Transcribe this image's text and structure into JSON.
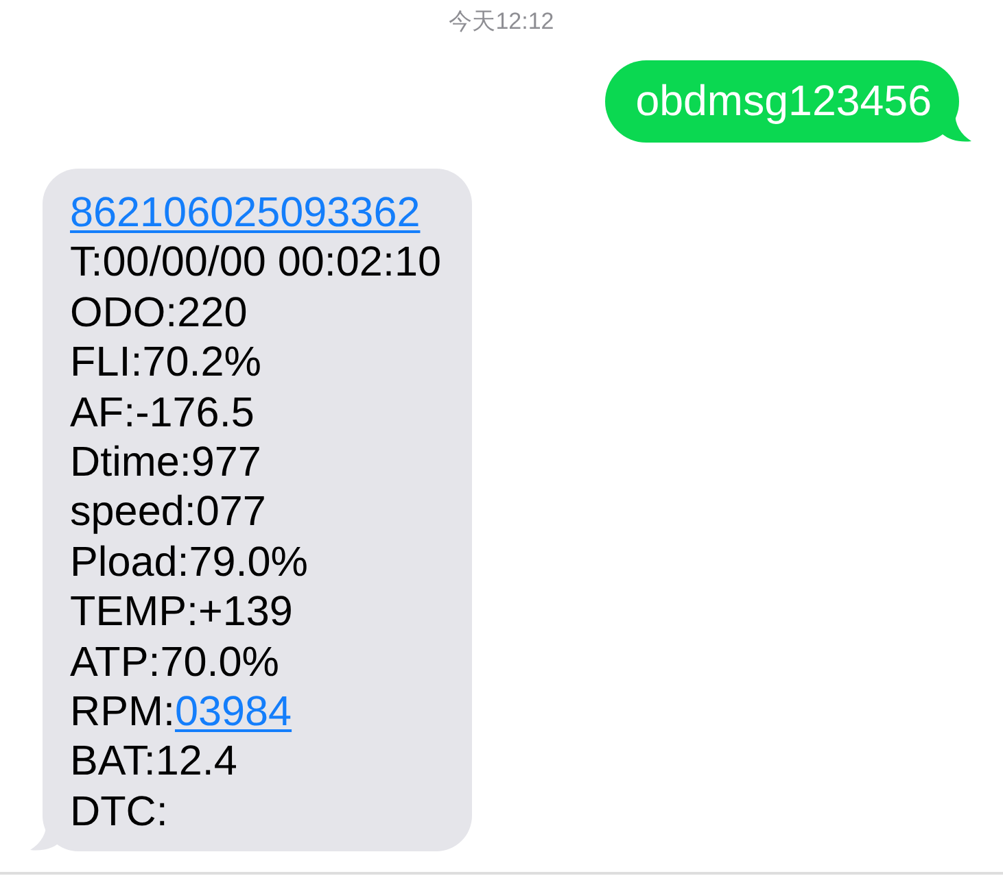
{
  "timestamp": "今天12:12",
  "messages": [
    {
      "kind": "sent",
      "lines": [
        {
          "text": "obdmsg123456"
        }
      ]
    },
    {
      "kind": "received",
      "lines": [
        {
          "link": "862106025093362"
        },
        {
          "text": "T:00/00/00 00:02:10"
        },
        {
          "text": "ODO:220"
        },
        {
          "text": "FLI:70.2%"
        },
        {
          "text": "AF:-176.5"
        },
        {
          "text": "Dtime:977"
        },
        {
          "text": "speed:077"
        },
        {
          "text": "Pload:79.0%"
        },
        {
          "text": "TEMP:+139"
        },
        {
          "text": "ATP:70.0%"
        },
        {
          "text": "RPM:",
          "link": "03984"
        },
        {
          "text": "BAT:12.4"
        },
        {
          "text": "DTC:"
        }
      ]
    }
  ]
}
